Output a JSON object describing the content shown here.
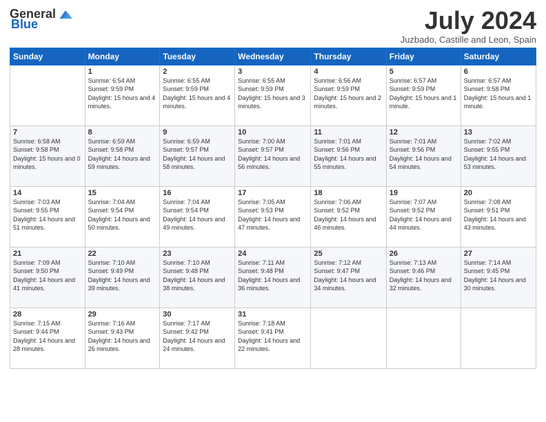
{
  "header": {
    "logo_general": "General",
    "logo_blue": "Blue",
    "month": "July 2024",
    "location": "Juzbado, Castille and Leon, Spain"
  },
  "days_of_week": [
    "Sunday",
    "Monday",
    "Tuesday",
    "Wednesday",
    "Thursday",
    "Friday",
    "Saturday"
  ],
  "weeks": [
    [
      {
        "day": "",
        "sunrise": "",
        "sunset": "",
        "daylight": ""
      },
      {
        "day": "1",
        "sunrise": "Sunrise: 6:54 AM",
        "sunset": "Sunset: 9:59 PM",
        "daylight": "Daylight: 15 hours and 4 minutes."
      },
      {
        "day": "2",
        "sunrise": "Sunrise: 6:55 AM",
        "sunset": "Sunset: 9:59 PM",
        "daylight": "Daylight: 15 hours and 4 minutes."
      },
      {
        "day": "3",
        "sunrise": "Sunrise: 6:55 AM",
        "sunset": "Sunset: 9:59 PM",
        "daylight": "Daylight: 15 hours and 3 minutes."
      },
      {
        "day": "4",
        "sunrise": "Sunrise: 6:56 AM",
        "sunset": "Sunset: 9:59 PM",
        "daylight": "Daylight: 15 hours and 2 minutes."
      },
      {
        "day": "5",
        "sunrise": "Sunrise: 6:57 AM",
        "sunset": "Sunset: 9:59 PM",
        "daylight": "Daylight: 15 hours and 1 minute."
      },
      {
        "day": "6",
        "sunrise": "Sunrise: 6:57 AM",
        "sunset": "Sunset: 9:58 PM",
        "daylight": "Daylight: 15 hours and 1 minute."
      }
    ],
    [
      {
        "day": "7",
        "sunrise": "Sunrise: 6:58 AM",
        "sunset": "Sunset: 9:58 PM",
        "daylight": "Daylight: 15 hours and 0 minutes."
      },
      {
        "day": "8",
        "sunrise": "Sunrise: 6:59 AM",
        "sunset": "Sunset: 9:58 PM",
        "daylight": "Daylight: 14 hours and 59 minutes."
      },
      {
        "day": "9",
        "sunrise": "Sunrise: 6:59 AM",
        "sunset": "Sunset: 9:57 PM",
        "daylight": "Daylight: 14 hours and 58 minutes."
      },
      {
        "day": "10",
        "sunrise": "Sunrise: 7:00 AM",
        "sunset": "Sunset: 9:57 PM",
        "daylight": "Daylight: 14 hours and 56 minutes."
      },
      {
        "day": "11",
        "sunrise": "Sunrise: 7:01 AM",
        "sunset": "Sunset: 9:56 PM",
        "daylight": "Daylight: 14 hours and 55 minutes."
      },
      {
        "day": "12",
        "sunrise": "Sunrise: 7:01 AM",
        "sunset": "Sunset: 9:56 PM",
        "daylight": "Daylight: 14 hours and 54 minutes."
      },
      {
        "day": "13",
        "sunrise": "Sunrise: 7:02 AM",
        "sunset": "Sunset: 9:55 PM",
        "daylight": "Daylight: 14 hours and 53 minutes."
      }
    ],
    [
      {
        "day": "14",
        "sunrise": "Sunrise: 7:03 AM",
        "sunset": "Sunset: 9:55 PM",
        "daylight": "Daylight: 14 hours and 51 minutes."
      },
      {
        "day": "15",
        "sunrise": "Sunrise: 7:04 AM",
        "sunset": "Sunset: 9:54 PM",
        "daylight": "Daylight: 14 hours and 50 minutes."
      },
      {
        "day": "16",
        "sunrise": "Sunrise: 7:04 AM",
        "sunset": "Sunset: 9:54 PM",
        "daylight": "Daylight: 14 hours and 49 minutes."
      },
      {
        "day": "17",
        "sunrise": "Sunrise: 7:05 AM",
        "sunset": "Sunset: 9:53 PM",
        "daylight": "Daylight: 14 hours and 47 minutes."
      },
      {
        "day": "18",
        "sunrise": "Sunrise: 7:06 AM",
        "sunset": "Sunset: 9:52 PM",
        "daylight": "Daylight: 14 hours and 46 minutes."
      },
      {
        "day": "19",
        "sunrise": "Sunrise: 7:07 AM",
        "sunset": "Sunset: 9:52 PM",
        "daylight": "Daylight: 14 hours and 44 minutes."
      },
      {
        "day": "20",
        "sunrise": "Sunrise: 7:08 AM",
        "sunset": "Sunset: 9:51 PM",
        "daylight": "Daylight: 14 hours and 43 minutes."
      }
    ],
    [
      {
        "day": "21",
        "sunrise": "Sunrise: 7:09 AM",
        "sunset": "Sunset: 9:50 PM",
        "daylight": "Daylight: 14 hours and 41 minutes."
      },
      {
        "day": "22",
        "sunrise": "Sunrise: 7:10 AM",
        "sunset": "Sunset: 9:49 PM",
        "daylight": "Daylight: 14 hours and 39 minutes."
      },
      {
        "day": "23",
        "sunrise": "Sunrise: 7:10 AM",
        "sunset": "Sunset: 9:48 PM",
        "daylight": "Daylight: 14 hours and 38 minutes."
      },
      {
        "day": "24",
        "sunrise": "Sunrise: 7:11 AM",
        "sunset": "Sunset: 9:48 PM",
        "daylight": "Daylight: 14 hours and 36 minutes."
      },
      {
        "day": "25",
        "sunrise": "Sunrise: 7:12 AM",
        "sunset": "Sunset: 9:47 PM",
        "daylight": "Daylight: 14 hours and 34 minutes."
      },
      {
        "day": "26",
        "sunrise": "Sunrise: 7:13 AM",
        "sunset": "Sunset: 9:46 PM",
        "daylight": "Daylight: 14 hours and 32 minutes."
      },
      {
        "day": "27",
        "sunrise": "Sunrise: 7:14 AM",
        "sunset": "Sunset: 9:45 PM",
        "daylight": "Daylight: 14 hours and 30 minutes."
      }
    ],
    [
      {
        "day": "28",
        "sunrise": "Sunrise: 7:15 AM",
        "sunset": "Sunset: 9:44 PM",
        "daylight": "Daylight: 14 hours and 28 minutes."
      },
      {
        "day": "29",
        "sunrise": "Sunrise: 7:16 AM",
        "sunset": "Sunset: 9:43 PM",
        "daylight": "Daylight: 14 hours and 26 minutes."
      },
      {
        "day": "30",
        "sunrise": "Sunrise: 7:17 AM",
        "sunset": "Sunset: 9:42 PM",
        "daylight": "Daylight: 14 hours and 24 minutes."
      },
      {
        "day": "31",
        "sunrise": "Sunrise: 7:18 AM",
        "sunset": "Sunset: 9:41 PM",
        "daylight": "Daylight: 14 hours and 22 minutes."
      },
      {
        "day": "",
        "sunrise": "",
        "sunset": "",
        "daylight": ""
      },
      {
        "day": "",
        "sunrise": "",
        "sunset": "",
        "daylight": ""
      },
      {
        "day": "",
        "sunrise": "",
        "sunset": "",
        "daylight": ""
      }
    ]
  ]
}
